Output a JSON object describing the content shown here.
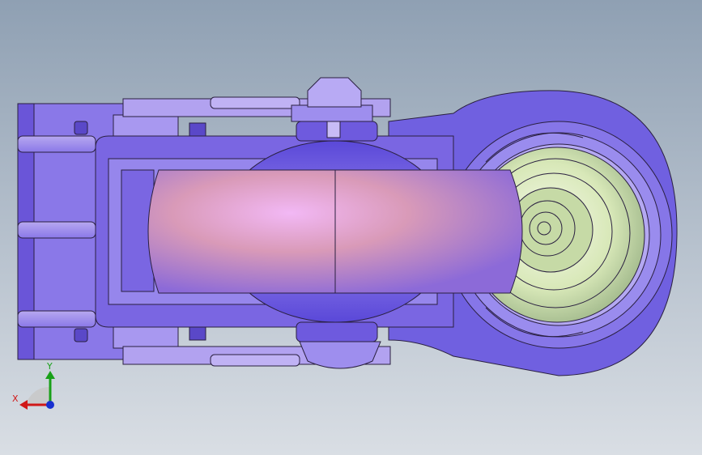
{
  "viewport": {
    "background_top": "#8FA0B3",
    "background_bottom": "#D9DEE4"
  },
  "model": {
    "frame_color": "#8A78E8",
    "frame_shade": "#6A55D8",
    "frame_light": "#B7A8F0",
    "wheel_color": "#D99AB8",
    "wheel_highlight": "#F2B8F5",
    "wheel_shadow": "#8C6AD8",
    "hub_color": "#D8E8B8",
    "hub_shade": "#9FB78A",
    "edge_color": "#2A2040"
  },
  "triad": {
    "x_label": "X",
    "y_label": "Y",
    "x_color": "#D01818",
    "y_color": "#18A018",
    "z_color": "#1830D0",
    "x_axis_icon": "x-axis-arrow-icon",
    "y_axis_icon": "y-axis-arrow-icon",
    "z_axis_icon": "z-axis-dot-icon"
  }
}
